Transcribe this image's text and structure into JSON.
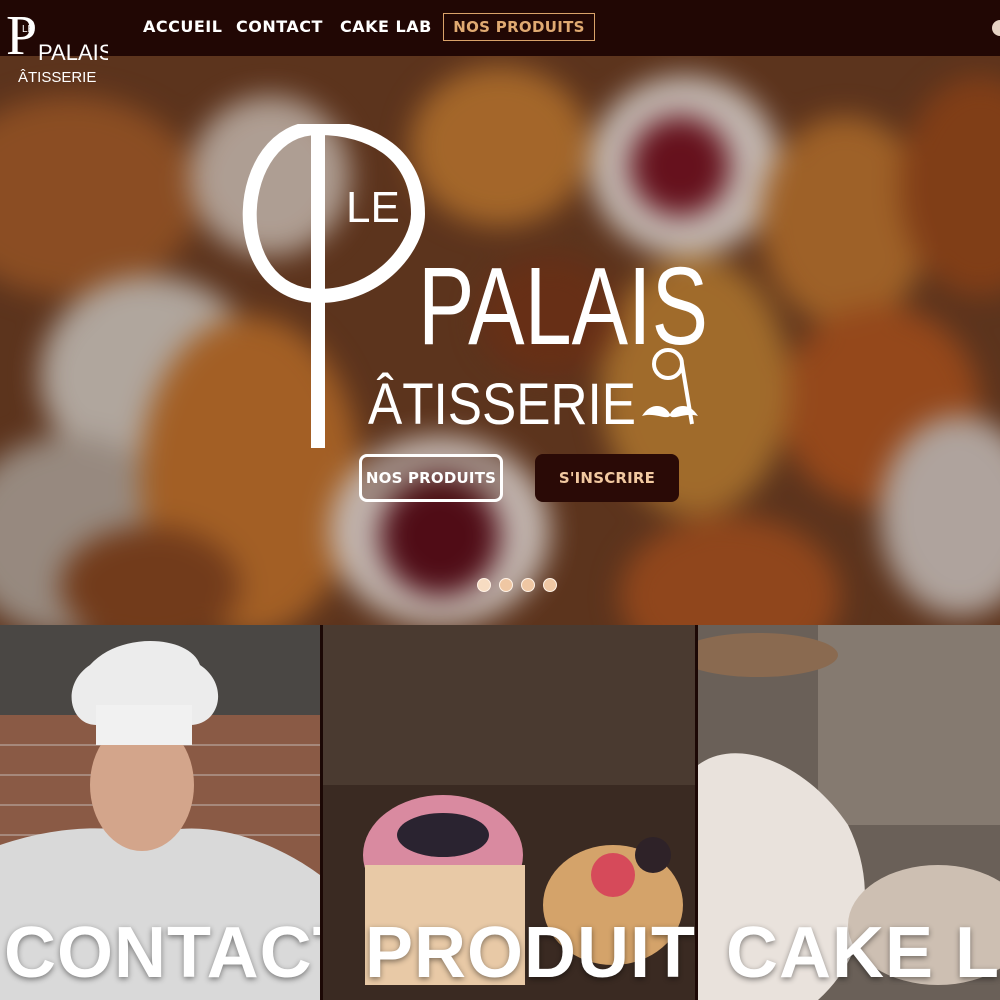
{
  "brand": {
    "le": "LE",
    "palais": "PALAIS",
    "patisserie": "ÂTISSERIE",
    "initial": "P"
  },
  "nav": {
    "links": [
      "ACCUEIL",
      "CONTACT",
      "CAKE LAB"
    ],
    "cta": "NOS PRODUITS"
  },
  "hero": {
    "buttons": {
      "products": "NOS PRODUITS",
      "signup": "S'INSCRIRE"
    },
    "carousel": {
      "slides": 4,
      "active": 0
    }
  },
  "panels": [
    "CONTACT",
    "PRODUITS",
    "CAKE LAB"
  ],
  "colors": {
    "nav_bg": "#210704",
    "accent": "#e0aa72",
    "signup_bg": "#2a0a06"
  }
}
